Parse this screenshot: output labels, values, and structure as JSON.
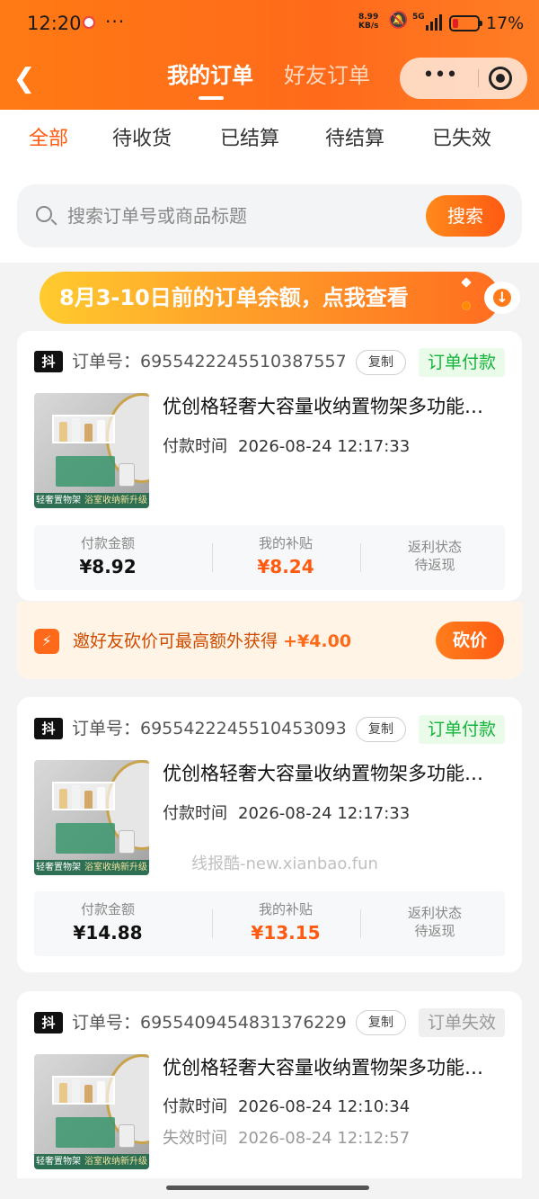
{
  "status_bar": {
    "time": "12:20",
    "dots": "···",
    "speed": "8.99\nKB/s",
    "network": "5G",
    "battery": "17%",
    "mute_icon": "bell-off-icon"
  },
  "header": {
    "back_icon": "chevron-left-icon",
    "tabs": [
      {
        "label": "我的订单",
        "active": true
      },
      {
        "label": "好友订单",
        "active": false
      }
    ],
    "capsule_more": "•••",
    "accent": "#ff6a1a"
  },
  "filters": {
    "items": [
      {
        "label": "全部",
        "active": true
      },
      {
        "label": "待收货",
        "active": false
      },
      {
        "label": "已结算",
        "active": false
      },
      {
        "label": "待结算",
        "active": false
      },
      {
        "label": "已失效",
        "active": false
      }
    ]
  },
  "search": {
    "placeholder": "搜索订单号或商品标题",
    "value": "",
    "button": "搜索"
  },
  "banner": {
    "text": "8月3-10日前的订单余额，点我查看"
  },
  "orders": [
    {
      "source": "抖",
      "order_no": "订单号：6955422245510387557",
      "copy": "复制",
      "status": "订单付款",
      "title": "优创格轻奢大容量收纳置物架多功能…",
      "pay_time_label": "付款时间",
      "pay_time": "2026-08-24 12:17:33",
      "stats": {
        "paid_label": "付款金额",
        "paid": "¥8.92",
        "subsidy_label": "我的补贴",
        "subsidy": "¥8.24",
        "rebate_label": "返利状态",
        "rebate": "待返现"
      },
      "image_caption": [
        "轻奢置物架",
        "浴室收纳新升级"
      ]
    },
    {
      "source": "抖",
      "order_no": "订单号：6955422245510453093",
      "copy": "复制",
      "status": "订单付款",
      "title": "优创格轻奢大容量收纳置物架多功能…",
      "pay_time_label": "付款时间",
      "pay_time": "2026-08-24 12:17:33",
      "stats": {
        "paid_label": "付款金额",
        "paid": "¥14.88",
        "subsidy_label": "我的补贴",
        "subsidy": "¥13.15",
        "rebate_label": "返利状态",
        "rebate": "待返现"
      },
      "image_caption": [
        "轻奢置物架",
        "浴室收纳新升级"
      ]
    },
    {
      "source": "抖",
      "order_no": "订单号：6955409454831376229",
      "copy": "复制",
      "status": "订单失效",
      "title": "优创格轻奢大容量收纳置物架多功能…",
      "pay_time_label": "付款时间",
      "pay_time": "2026-08-24 12:10:34",
      "expire_label": "失效时间",
      "expire_time": "2026-08-24 12:12:57",
      "image_caption": [
        "轻奢置物架",
        "浴室收纳新升级"
      ]
    }
  ],
  "bargain": {
    "text": "邀好友砍价可最高额外获得",
    "amount": "+¥4.00",
    "button": "砍价"
  },
  "watermark": "线报酷-new.xianbao.fun"
}
